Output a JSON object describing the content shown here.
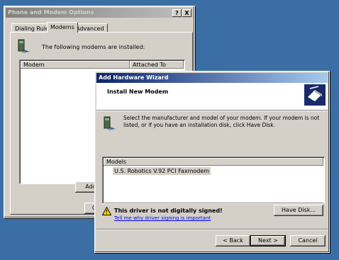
{
  "back_window": {
    "title": "Phone and Modem Options",
    "help_btn": "?",
    "close_btn": "X",
    "tabs": [
      "Dialing Rules",
      "Modems",
      "Advanced"
    ],
    "info_text": "The following modems are  installed:",
    "columns": [
      "Modem",
      "Attached To"
    ],
    "add_label": "Add",
    "ok_label": "O"
  },
  "wizard": {
    "title": "Add Hardware Wizard",
    "header": "Install New Modem",
    "instruction": "Select the manufacturer and model of your modem. If your modem is not listed, or if you have an installation disk, click Have Disk.",
    "models_header": "Models",
    "models": [
      "U.S. Robotics V.92 PCI Faxmodem"
    ],
    "warning": "This driver is not digitally signed!",
    "link": "Tell me why driver signing is important",
    "have_disk": "Have Disk...",
    "back": "< Back",
    "next": "Next >",
    "cancel": "Cancel"
  },
  "colors": {
    "desktop": "#3a6ea5",
    "face": "#d4d0c8",
    "active_title": "#0a246a",
    "selection": "#d4d0c8"
  }
}
